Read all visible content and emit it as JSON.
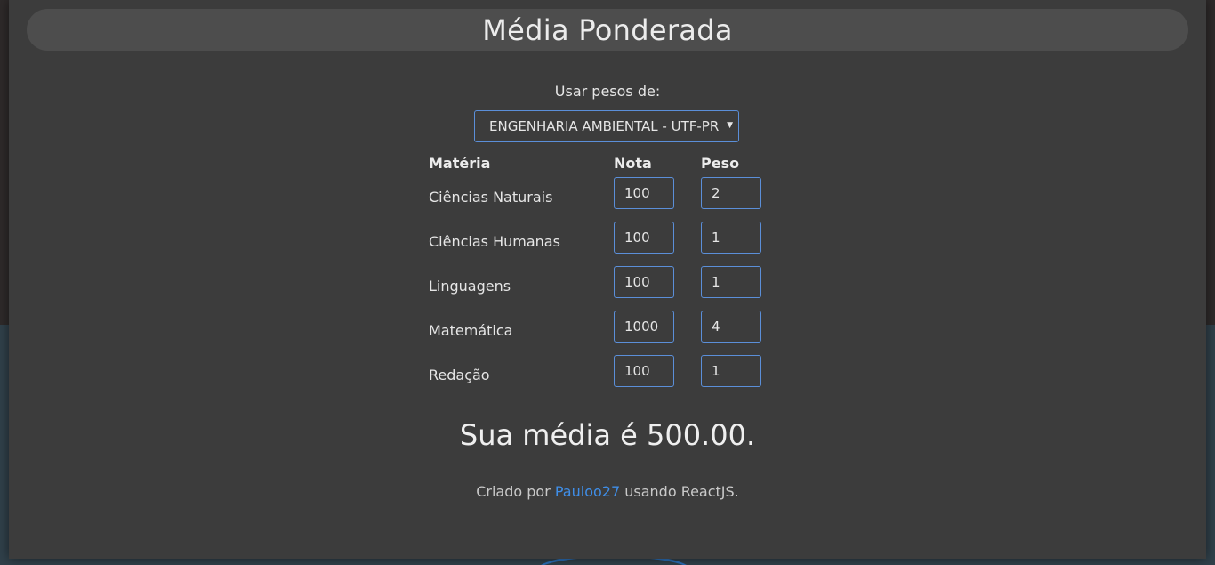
{
  "page": {
    "title": "Média Ponderada",
    "weights_label": "Usar pesos de:",
    "weights_select_value": "ENGENHARIA AMBIENTAL - UTF-PR"
  },
  "table": {
    "headers": {
      "subject": "Matéria",
      "grade": "Nota",
      "weight": "Peso"
    },
    "rows": [
      {
        "subject": "Ciências Naturais",
        "grade": "100",
        "weight": "2"
      },
      {
        "subject": "Ciências Humanas",
        "grade": "100",
        "weight": "1"
      },
      {
        "subject": "Linguagens",
        "grade": "100",
        "weight": "1"
      },
      {
        "subject": "Matemática",
        "grade": "1000",
        "weight": "4"
      },
      {
        "subject": "Redação",
        "grade": "100",
        "weight": "1"
      }
    ]
  },
  "result": {
    "text": "Sua média é 500.00."
  },
  "footer": {
    "prefix": "Criado por",
    "author": "Pauloo27",
    "suffix": "usando ReactJS."
  },
  "colors": {
    "panel_bg": "#3c3c3c",
    "title_bar_bg": "#4d4d4d",
    "input_border": "#5b8fd9",
    "link": "#3f8ee8"
  }
}
